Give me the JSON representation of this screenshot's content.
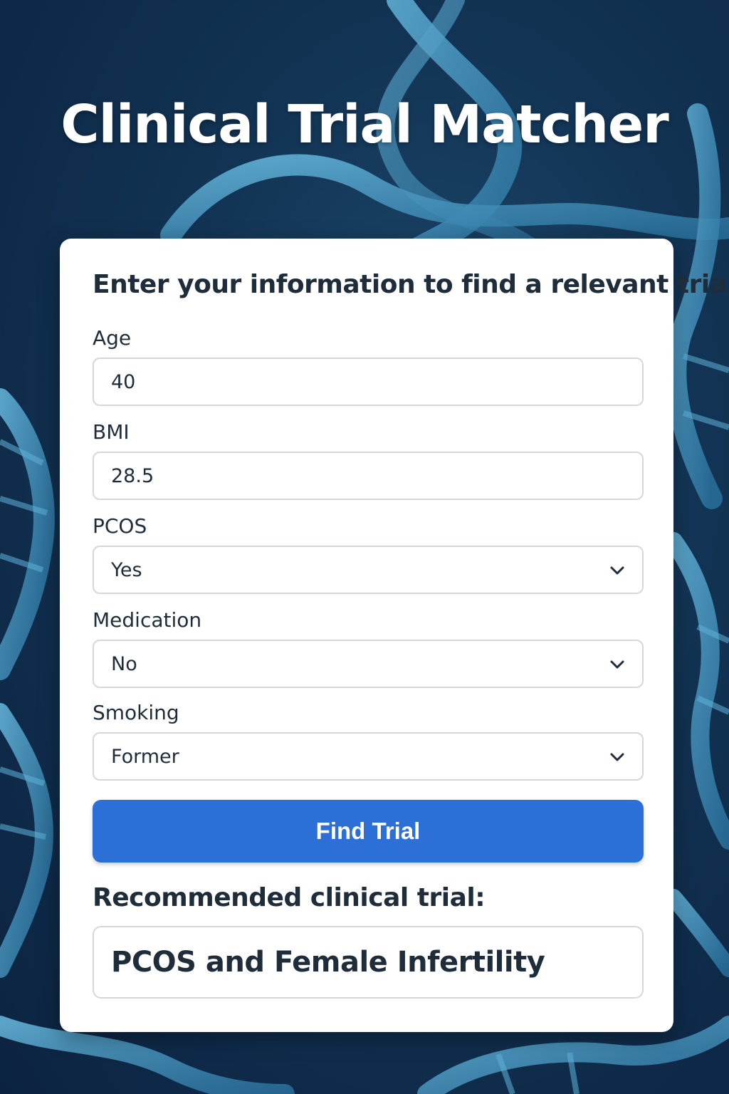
{
  "header": {
    "title": "Clinical Trial Matcher"
  },
  "form": {
    "heading": "Enter your information to find a relevant trial:",
    "fields": [
      {
        "label": "Age",
        "value": "40",
        "type": "input"
      },
      {
        "label": "BMI",
        "value": "28.5",
        "type": "input"
      },
      {
        "label": "PCOS",
        "value": "Yes",
        "type": "select",
        "icon": "chevron-down-icon"
      },
      {
        "label": "Medication",
        "value": "No",
        "type": "select",
        "icon": "chevron-down-icon"
      },
      {
        "label": "Smoking",
        "value": "Former",
        "type": "select",
        "icon": "chevron-down-icon"
      }
    ],
    "submit_label": "Find Trial"
  },
  "result": {
    "heading": "Recommended clinical trial:",
    "value": "PCOS and Female Infertility"
  },
  "colors": {
    "background": "#123353",
    "dna_strand": "#4a9fc8",
    "button": "#2c6fd6",
    "text": "#1f2d3a"
  },
  "background_art": "dna-helix-illustration"
}
